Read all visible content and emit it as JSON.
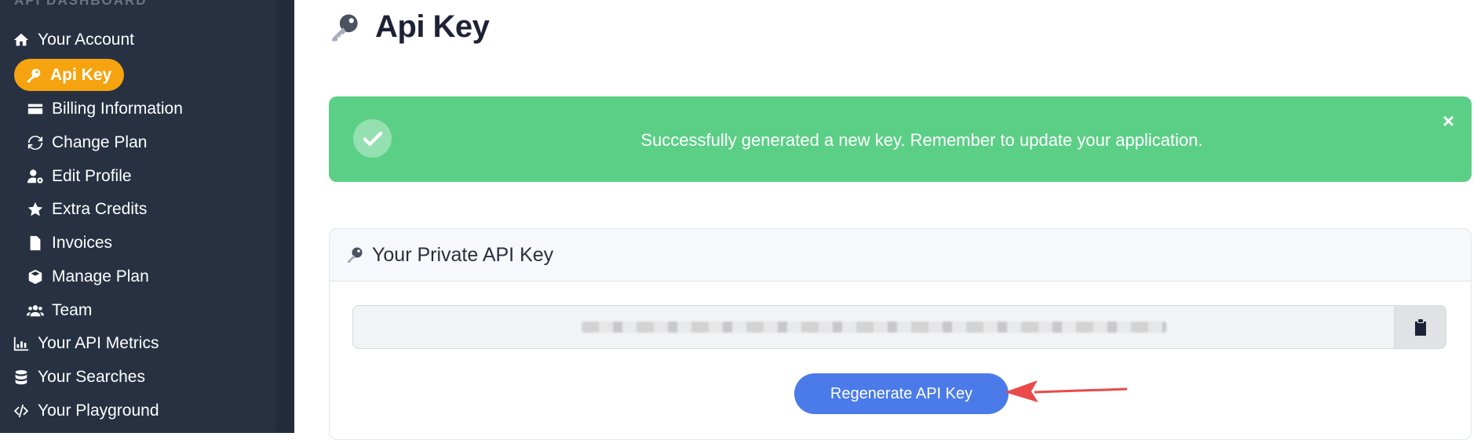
{
  "sidebar": {
    "heading": "API DASHBOARD",
    "items": [
      {
        "label": "Your Account",
        "icon": "home-icon"
      },
      {
        "label": "Api Key",
        "icon": "key-icon",
        "active": true
      },
      {
        "label": "Billing Information",
        "icon": "credit-card-icon"
      },
      {
        "label": "Change Plan",
        "icon": "sync-icon"
      },
      {
        "label": "Edit Profile",
        "icon": "user-cog-icon"
      },
      {
        "label": "Extra Credits",
        "icon": "star-icon"
      },
      {
        "label": "Invoices",
        "icon": "file-icon"
      },
      {
        "label": "Manage Plan",
        "icon": "box-icon"
      },
      {
        "label": "Team",
        "icon": "users-icon"
      },
      {
        "label": "Your API Metrics",
        "icon": "chart-icon"
      },
      {
        "label": "Your Searches",
        "icon": "database-icon"
      },
      {
        "label": "Your Playground",
        "icon": "code-icon"
      }
    ],
    "active_color": "#f5a30f"
  },
  "main": {
    "title": "Api Key",
    "alert": {
      "message": "Successfully generated a new key. Remember to update your application.",
      "close": "×",
      "color": "#5bcf86"
    },
    "card": {
      "header": "Your Private API Key",
      "regenerate_label": "Regenerate API Key",
      "button_color": "#4b7be8"
    }
  }
}
